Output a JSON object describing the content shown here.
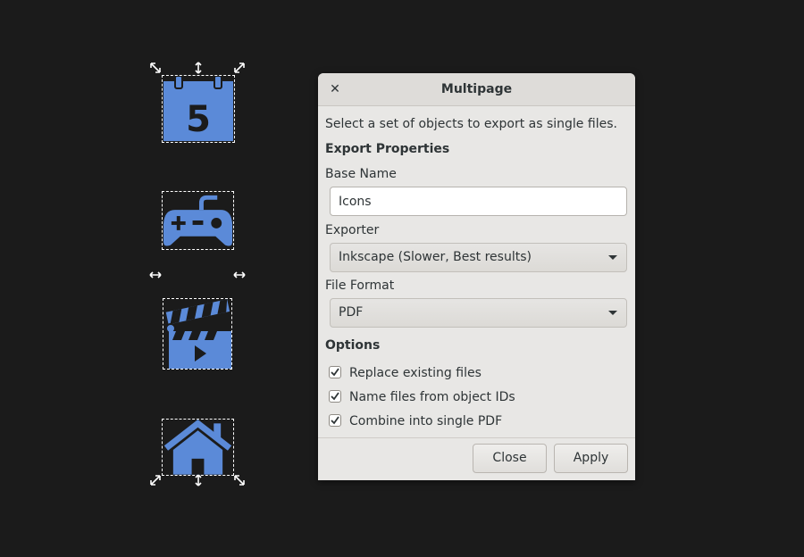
{
  "canvas": {
    "background": "#1b1b1b",
    "icon_color": "#5b8ad8",
    "objects": [
      {
        "name": "calendar-icon",
        "text": "5"
      },
      {
        "name": "gamepad-icon"
      },
      {
        "name": "clapperboard-icon"
      },
      {
        "name": "house-icon"
      }
    ]
  },
  "dialog": {
    "title": "Multipage",
    "close_glyph": "✕",
    "description": "Select a set of objects to export as single files.",
    "export_properties_heading": "Export Properties",
    "base_name": {
      "label": "Base Name",
      "value": "Icons"
    },
    "exporter": {
      "label": "Exporter",
      "selected": "Inkscape (Slower, Best results)"
    },
    "file_format": {
      "label": "File Format",
      "selected": "PDF"
    },
    "options_heading": "Options",
    "options": [
      {
        "label": "Replace existing files",
        "checked": true
      },
      {
        "label": "Name files from object IDs",
        "checked": true
      },
      {
        "label": "Combine into single PDF",
        "checked": true
      }
    ],
    "buttons": {
      "close": "Close",
      "apply": "Apply"
    }
  }
}
